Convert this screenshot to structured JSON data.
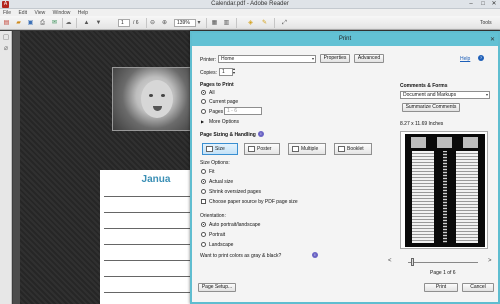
{
  "app": {
    "window_title": "Calendar.pdf - Adobe Reader",
    "menu": [
      "File",
      "Edit",
      "View",
      "Window",
      "Help"
    ],
    "toolbar": {
      "page_current": "1",
      "page_total": "/ 6",
      "zoom": "139%",
      "tools_label": "Tools"
    }
  },
  "document": {
    "month_text": "Janua"
  },
  "dialog": {
    "title": "Print",
    "help_label": "Help",
    "printer": {
      "label": "Printer:",
      "value": "Home",
      "properties_label": "Properties",
      "advanced_label": "Advanced"
    },
    "copies": {
      "label": "Copies:",
      "value": "1"
    },
    "pages_to_print": {
      "heading": "Pages to Print",
      "options": [
        "All",
        "Current page",
        "Pages"
      ],
      "selected": "All",
      "pages_placeholder": "1 - 6",
      "more_options": "More Options"
    },
    "sizing": {
      "heading": "Page Sizing & Handling",
      "buttons": [
        "Size",
        "Poster",
        "Multiple",
        "Booklet"
      ],
      "selected": "Size",
      "size_options_heading": "Size Options:",
      "size_options": [
        "Fit",
        "Actual size",
        "Shrink oversized pages"
      ],
      "size_selected": "Actual size",
      "pdf_paper_source": "Choose paper source by PDF page size"
    },
    "orientation": {
      "heading": "Orientation:",
      "options": [
        "Auto portrait/landscape",
        "Portrait",
        "Landscape"
      ],
      "selected": "Auto portrait/landscape"
    },
    "grayscale_question": "Want to print colors as gray & black?",
    "comments": {
      "heading": "Comments & Forms",
      "value": "Document and Markups",
      "summarize_label": "Summarize Comments"
    },
    "preview": {
      "dimensions": "8.27 x 11.69 Inches",
      "page_status": "Page 1 of 6"
    },
    "page_setup_label": "Page Setup...",
    "print_label": "Print",
    "cancel_label": "Cancel"
  },
  "colors": {
    "dialog_accent": "#62c1d4",
    "month_text": "#3a8fb5",
    "selected_button": "#c4e2f7",
    "help_link": "#1e5fb8"
  }
}
